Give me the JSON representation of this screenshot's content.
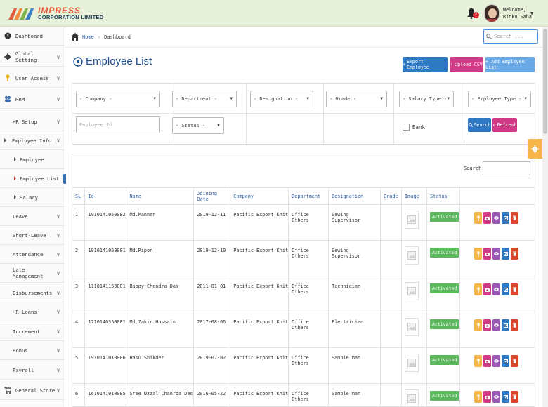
{
  "brand": {
    "name_top": "IMPRESS",
    "name_bottom": "CORPORATION LIMITED"
  },
  "user": {
    "welcome": "Welcome,",
    "name": "Rinku Saha",
    "notification_count": "2"
  },
  "sidebar": {
    "items": [
      {
        "label": "Dashboard"
      },
      {
        "label": "Global Setting"
      },
      {
        "label": "User Access"
      },
      {
        "label": "HRM"
      },
      {
        "label": "HR Setup"
      },
      {
        "label": "Employee Info"
      },
      {
        "label": "Employee"
      },
      {
        "label": "Employee List"
      },
      {
        "label": "Salary"
      },
      {
        "label": "Leave"
      },
      {
        "label": "Short-Leave"
      },
      {
        "label": "Attendance"
      },
      {
        "label": "Late Management"
      },
      {
        "label": "Disbursements"
      },
      {
        "label": "HR Loans"
      },
      {
        "label": "Increment"
      },
      {
        "label": "Bonus"
      },
      {
        "label": "Payroll"
      },
      {
        "label": "General Store"
      }
    ]
  },
  "breadcrumb": {
    "home": "Home",
    "current": "Dashboard"
  },
  "top_search": {
    "placeholder": "Search ..."
  },
  "page": {
    "title": "Employee List"
  },
  "buttons": {
    "export": "Export Employee",
    "upload": "Upload CSV",
    "add": "+ Add Employee List"
  },
  "filters": {
    "company": "- Company -",
    "department": "- Department -",
    "designation": "- Designation -",
    "grade": "- Grade -",
    "salary_type": "- Salary Type -",
    "employee_type": "- Employee Type -",
    "employee_id_placeholder": "Employee Id",
    "status": "- Status -",
    "bank_label": "Bank",
    "search_btn": "Search",
    "refresh_btn": "Refresh"
  },
  "table": {
    "search_label": "Search:",
    "headers": [
      "SL",
      "Id",
      "Name",
      "Joining Date",
      "Company",
      "Department",
      "Designation",
      "Grade",
      "Image",
      "Status",
      ""
    ],
    "rows": [
      {
        "sl": "1",
        "id": "1910141050002",
        "name": "Md.Mannan",
        "date": "2019-12-11",
        "company": "Pacific Export Knit",
        "dept": "Office Others",
        "desig": "Sewing Supervisor",
        "grade": "",
        "status": "Activated"
      },
      {
        "sl": "2",
        "id": "1910141050001",
        "name": "Md.Ripon",
        "date": "2019-12-10",
        "company": "Pacific Export Knit",
        "dept": "Office Others",
        "desig": "Sewing Supervisor",
        "grade": "",
        "status": "Activated"
      },
      {
        "sl": "3",
        "id": "1110141150001",
        "name": "Bappy Chondra Das",
        "date": "2011-01-01",
        "company": "Pacific Export Knit",
        "dept": "Office Others",
        "desig": "Technician",
        "grade": "",
        "status": "Activated"
      },
      {
        "sl": "4",
        "id": "1710140350001",
        "name": "Md.Zakir Hossain",
        "date": "2017-08-06",
        "company": "Pacific Export Knit",
        "dept": "Office Others",
        "desig": "Electrician",
        "grade": "",
        "status": "Activated"
      },
      {
        "sl": "5",
        "id": "1910141010006",
        "name": "Hasu Shikder",
        "date": "2019-07-02",
        "company": "Pacific Export Knit",
        "dept": "Office Others",
        "desig": "Sample man",
        "grade": "",
        "status": "Activated"
      },
      {
        "sl": "6",
        "id": "1610141010005",
        "name": "Sree Uzzal Chanrda Das",
        "date": "2016-05-22",
        "company": "Pacific Export Knit",
        "dept": "Office Others",
        "desig": "Sample man",
        "grade": "",
        "status": "Activated"
      }
    ]
  },
  "colors": {
    "accent": "#1f4e8c",
    "topbar": "#e7f0d8",
    "status_green": "#5cb85c",
    "export_blue": "#2f78c4",
    "upload_pink": "#d13a86",
    "add_blue": "#6aa8e6",
    "gear_orange": "#f5b548"
  },
  "action_icons": [
    "key-icon",
    "camera-icon",
    "eye-icon",
    "edit-icon",
    "trash-icon"
  ]
}
